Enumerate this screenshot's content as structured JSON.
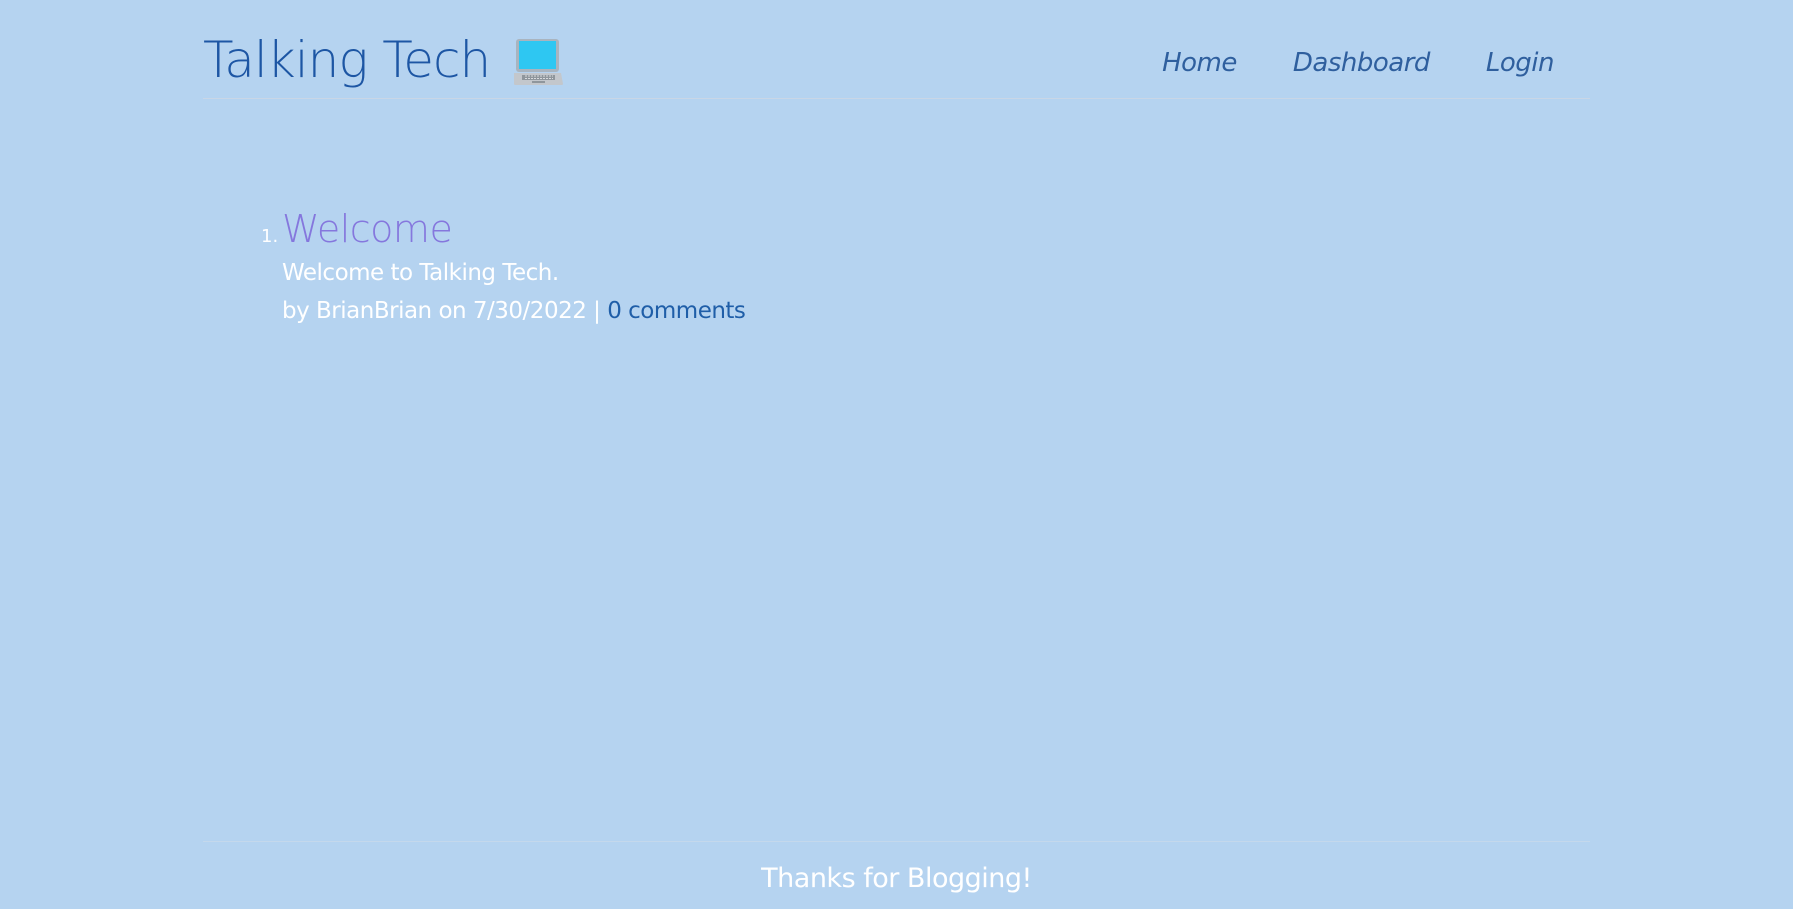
{
  "header": {
    "title": "Talking Tech",
    "logo_icon": "laptop-icon",
    "nav": {
      "home": "Home",
      "dashboard": "Dashboard",
      "login": "Login"
    }
  },
  "posts": [
    {
      "number": "1.",
      "title": "Welcome",
      "body": "Welcome to Talking Tech.",
      "meta_prefix": "by",
      "author": "BrianBrian",
      "date_prefix": "on",
      "date": "7/30/2022",
      "separator": "|",
      "comments": "0 comments"
    }
  ],
  "footer": {
    "text": "Thanks for Blogging!"
  },
  "colors": {
    "background": "#b5d3f0",
    "brand": "#1d56a4",
    "post_title": "#8577dd",
    "link": "#1f5ea8"
  }
}
